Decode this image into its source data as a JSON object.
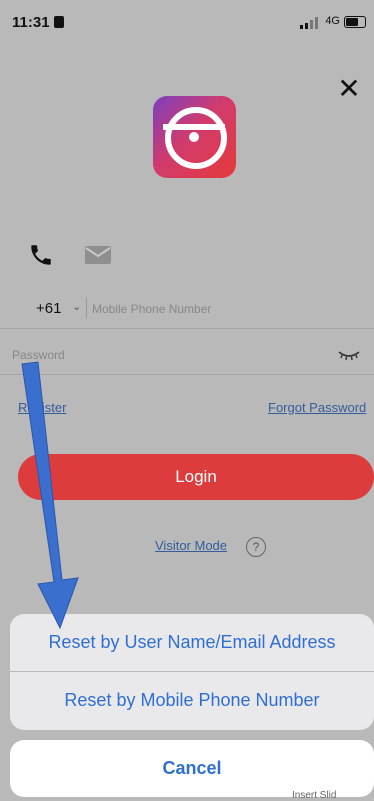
{
  "status_bar": {
    "time": "11:31",
    "network": "4G"
  },
  "login_screen": {
    "close_symbol": "✕",
    "country_code": "+61",
    "phone_placeholder": "Mobile Phone Number",
    "password_placeholder": "Password",
    "register_link": "Register",
    "forgot_password_link": "Forgot Password",
    "login_button": "Login",
    "visitor_mode_link": "Visitor Mode",
    "help_symbol": "?"
  },
  "action_sheet": {
    "options": [
      "Reset by User Name/Email Address",
      "Reset by Mobile Phone Number"
    ],
    "cancel_label": "Cancel"
  },
  "bottom_note": "Insert Slid",
  "colors": {
    "accent_red": "#dd3c3c",
    "link_blue": "#2f6fd1",
    "annotation_arrow": "#3a6fd0"
  },
  "icons": {
    "phone_tab": "phone-icon",
    "email_tab": "mail-icon",
    "password_visibility": "eye-closed-icon",
    "close": "close-icon",
    "help": "help-icon"
  }
}
